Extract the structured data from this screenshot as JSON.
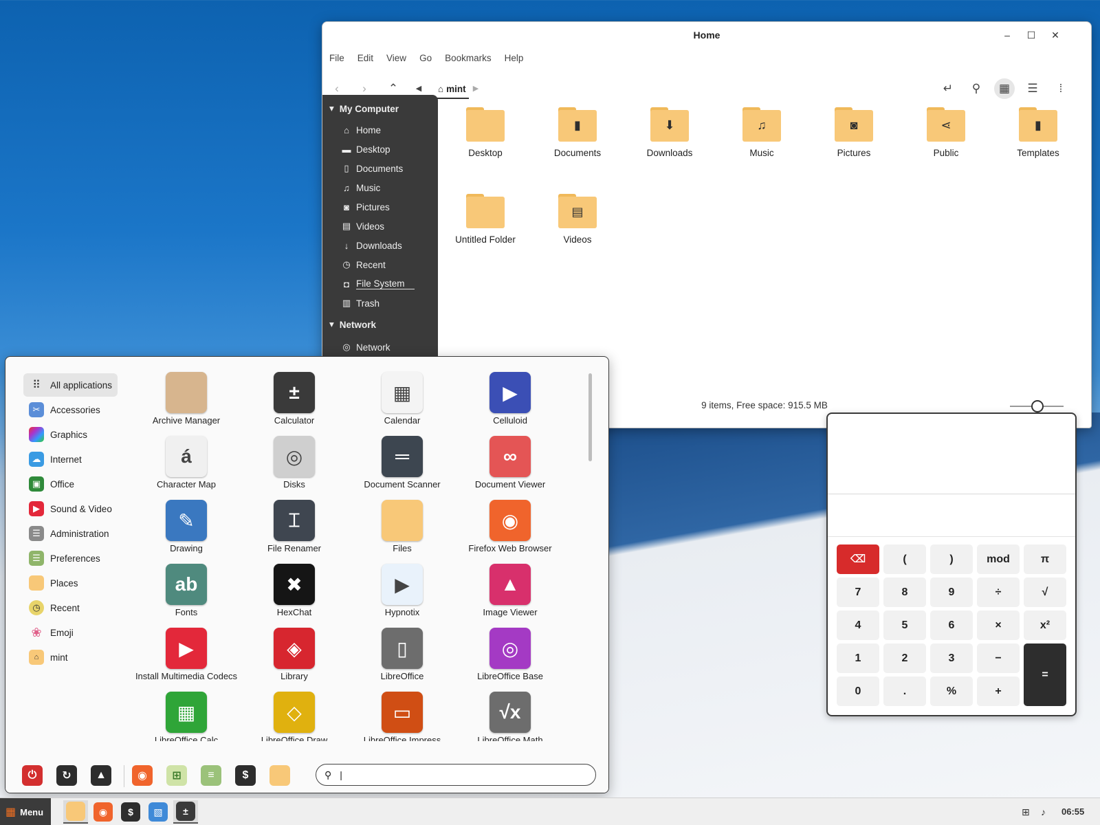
{
  "file_manager": {
    "title": "Home",
    "menubar": [
      "File",
      "Edit",
      "View",
      "Go",
      "Bookmarks",
      "Help"
    ],
    "breadcrumb": "mint",
    "sidebar": {
      "sections": [
        {
          "title": "My Computer",
          "items": [
            {
              "label": "Home",
              "icon": "home-icon"
            },
            {
              "label": "Desktop",
              "icon": "desktop-icon"
            },
            {
              "label": "Documents",
              "icon": "document-icon"
            },
            {
              "label": "Music",
              "icon": "music-icon"
            },
            {
              "label": "Pictures",
              "icon": "camera-icon"
            },
            {
              "label": "Videos",
              "icon": "film-icon"
            },
            {
              "label": "Downloads",
              "icon": "download-icon"
            },
            {
              "label": "Recent",
              "icon": "clock-icon"
            },
            {
              "label": "File System",
              "icon": "drive-icon"
            },
            {
              "label": "Trash",
              "icon": "trash-icon"
            }
          ]
        },
        {
          "title": "Network",
          "items": [
            {
              "label": "Network",
              "icon": "network-icon"
            }
          ]
        }
      ]
    },
    "files": [
      {
        "label": "Desktop",
        "icon": "folder-icon"
      },
      {
        "label": "Documents",
        "icon": "folder-document-icon"
      },
      {
        "label": "Downloads",
        "icon": "folder-download-icon"
      },
      {
        "label": "Music",
        "icon": "folder-music-icon"
      },
      {
        "label": "Pictures",
        "icon": "folder-camera-icon"
      },
      {
        "label": "Public",
        "icon": "folder-share-icon"
      },
      {
        "label": "Templates",
        "icon": "folder-template-icon"
      },
      {
        "label": "Untitled Folder",
        "icon": "folder-icon"
      },
      {
        "label": "Videos",
        "icon": "folder-film-icon"
      }
    ],
    "status": "9 items, Free space: 915.5 MB"
  },
  "calculator": {
    "keys": [
      [
        "",
        "(",
        ")",
        "mod",
        "π"
      ],
      [
        "7",
        "8",
        "9",
        "÷",
        "√"
      ],
      [
        "4",
        "5",
        "6",
        "×",
        "x²"
      ],
      [
        "1",
        "2",
        "3",
        "−",
        "="
      ],
      [
        "0",
        ".",
        "%",
        "+"
      ]
    ]
  },
  "app_menu": {
    "categories": [
      {
        "label": "All applications",
        "icon": "grid-icon",
        "selected": true
      },
      {
        "label": "Accessories",
        "icon": "scissors-icon"
      },
      {
        "label": "Graphics",
        "icon": "palette-icon"
      },
      {
        "label": "Internet",
        "icon": "cloud-icon"
      },
      {
        "label": "Office",
        "icon": "office-icon"
      },
      {
        "label": "Sound & Video",
        "icon": "play-icon"
      },
      {
        "label": "Administration",
        "icon": "admin-icon"
      },
      {
        "label": "Preferences",
        "icon": "preferences-icon"
      },
      {
        "label": "Places",
        "icon": "folder-icon"
      },
      {
        "label": "Recent",
        "icon": "clock-icon"
      },
      {
        "label": "Emoji",
        "icon": "flower-icon"
      },
      {
        "label": "mint",
        "icon": "home-folder-icon"
      }
    ],
    "apps": [
      {
        "label": "Archive Manager",
        "color": "#d7b58e"
      },
      {
        "label": "Calculator",
        "color": "#3a3a3a"
      },
      {
        "label": "Calendar",
        "color": "#f4f4f4"
      },
      {
        "label": "Celluloid",
        "color": "#3b4fb5"
      },
      {
        "label": "Character Map",
        "color": "#f0f0f0"
      },
      {
        "label": "Disks",
        "color": "#cfcfcf"
      },
      {
        "label": "Document Scanner",
        "color": "#3d4650"
      },
      {
        "label": "Document Viewer",
        "color": "#e45555"
      },
      {
        "label": "Drawing",
        "color": "#3a78c0"
      },
      {
        "label": "File Renamer",
        "color": "#3f4650"
      },
      {
        "label": "Files",
        "color": "#f8c878"
      },
      {
        "label": "Firefox Web Browser",
        "color": "#f0642c"
      },
      {
        "label": "Fonts",
        "color": "#4f8a7e"
      },
      {
        "label": "HexChat",
        "color": "#151515"
      },
      {
        "label": "Hypnotix",
        "color": "#e9f2fb"
      },
      {
        "label": "Image Viewer",
        "color": "#d8306c"
      },
      {
        "label": "Install Multimedia Codecs",
        "color": "#e3283a"
      },
      {
        "label": "Library",
        "color": "#d7262f"
      },
      {
        "label": "LibreOffice",
        "color": "#6d6d6d"
      },
      {
        "label": "LibreOffice Base",
        "color": "#a43ac4"
      },
      {
        "label": "LibreOffice Calc",
        "color": "#2fa538"
      },
      {
        "label": "LibreOffice Draw",
        "color": "#e0b10f"
      },
      {
        "label": "LibreOffice Impress",
        "color": "#d04e14"
      },
      {
        "label": "LibreOffice Math",
        "color": "#6d6d6d"
      }
    ],
    "search_value": "",
    "favorites": [
      "power-icon",
      "logout-icon",
      "lock-icon",
      "firefox-icon",
      "calc-icon",
      "settings-icon",
      "terminal-icon",
      "files-icon"
    ]
  },
  "taskbar": {
    "menu_label": "Menu",
    "clock": "06:55",
    "apps": [
      "files-icon",
      "firefox-icon",
      "terminal-icon",
      "text-editor-icon",
      "calculator-icon"
    ]
  }
}
